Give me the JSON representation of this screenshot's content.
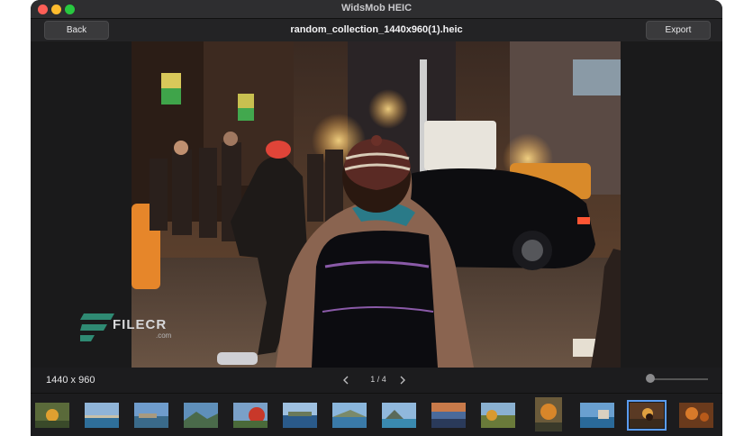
{
  "window": {
    "title": "WidsMob HEIC"
  },
  "toolbar": {
    "back_label": "Back",
    "export_label": "Export",
    "filename": "random_collection_1440x960(1).heic"
  },
  "status": {
    "dimensions": "1440 x 960",
    "page_indicator": "1 / 4",
    "zoom_level": 0.05
  },
  "watermark": {
    "brand": "FILECR",
    "suffix": ".com"
  },
  "icons": {
    "prev": "chevron-left-icon",
    "next": "chevron-right-icon"
  },
  "colors": {
    "selection": "#5b9cf0",
    "close": "#ff5f57",
    "minimize": "#febc2e",
    "zoom": "#28c840"
  },
  "thumbnails": {
    "count": 14,
    "selected_index": 12
  }
}
